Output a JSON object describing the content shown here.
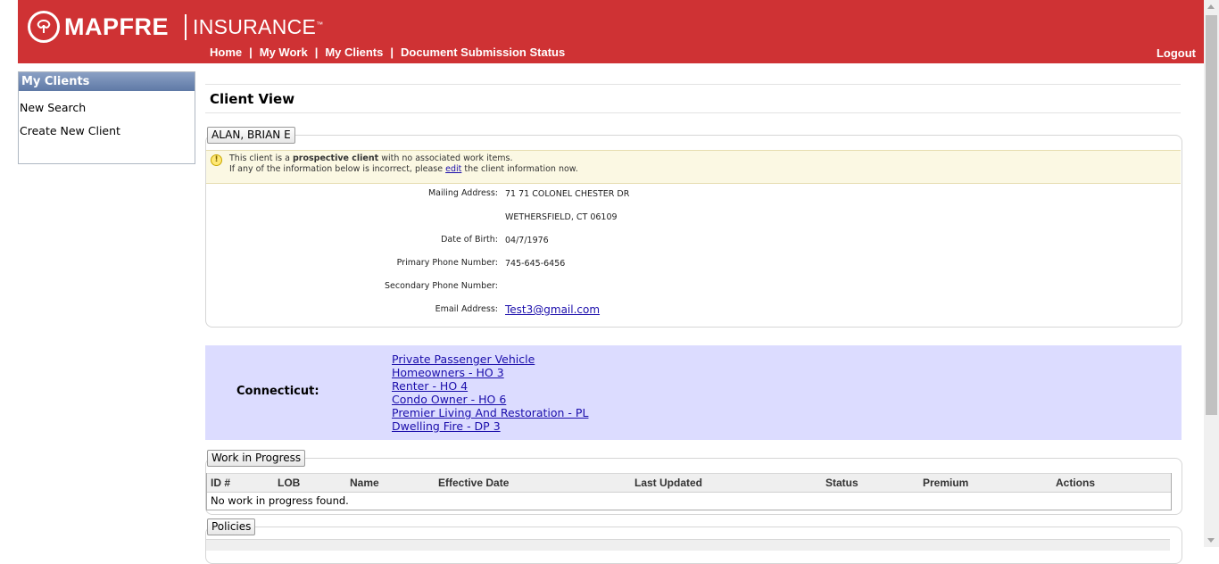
{
  "header": {
    "brand": "MAPFRE",
    "brand_sub": "INSURANCE",
    "brand_tm": "™",
    "nav": [
      "Home",
      "My Work",
      "My Clients",
      "Document Submission Status"
    ],
    "nav_sep": "|",
    "logout": "Logout",
    "brand_color": "#cf3234"
  },
  "sidebar": {
    "title": "My Clients",
    "items": [
      "New Search",
      "Create New Client"
    ]
  },
  "page": {
    "title": "Client View"
  },
  "client": {
    "name": "ALAN, BRIAN E",
    "notice": {
      "l1_a": "This client is a ",
      "l1_b": "prospective client",
      "l1_c": " with no associated work items.",
      "l2_a": "If any of the information below is incorrect, please ",
      "l2_link": "edit",
      "l2_c": " the client information now."
    },
    "fields": {
      "mailing_label": "Mailing Address:",
      "mailing_line1": "71 71 COLONEL CHESTER DR",
      "mailing_line2": "WETHERSFIELD, CT 06109",
      "dob_label": "Date of Birth:",
      "dob": "04/7/1976",
      "primary_label": "Primary Phone Number:",
      "primary": "745-645-6456",
      "secondary_label": "Secondary Phone Number:",
      "secondary": "",
      "email_label": "Email Address:",
      "email": "Test3@gmail.com"
    }
  },
  "state": {
    "label": "Connecticut:",
    "products": [
      "Private Passenger Vehicle",
      "Homeowners - HO 3",
      "Renter - HO 4",
      "Condo Owner - HO 6",
      "Premier Living And Restoration - PL",
      "Dwelling Fire - DP 3"
    ],
    "band_color": "#dcdcff"
  },
  "work_in_progress": {
    "legend": "Work in Progress",
    "columns": [
      "ID #",
      "LOB",
      "Name",
      "Effective Date",
      "Last Updated",
      "Status",
      "Premium",
      "Actions"
    ],
    "empty": "No work in progress found."
  },
  "policies": {
    "legend": "Policies"
  }
}
